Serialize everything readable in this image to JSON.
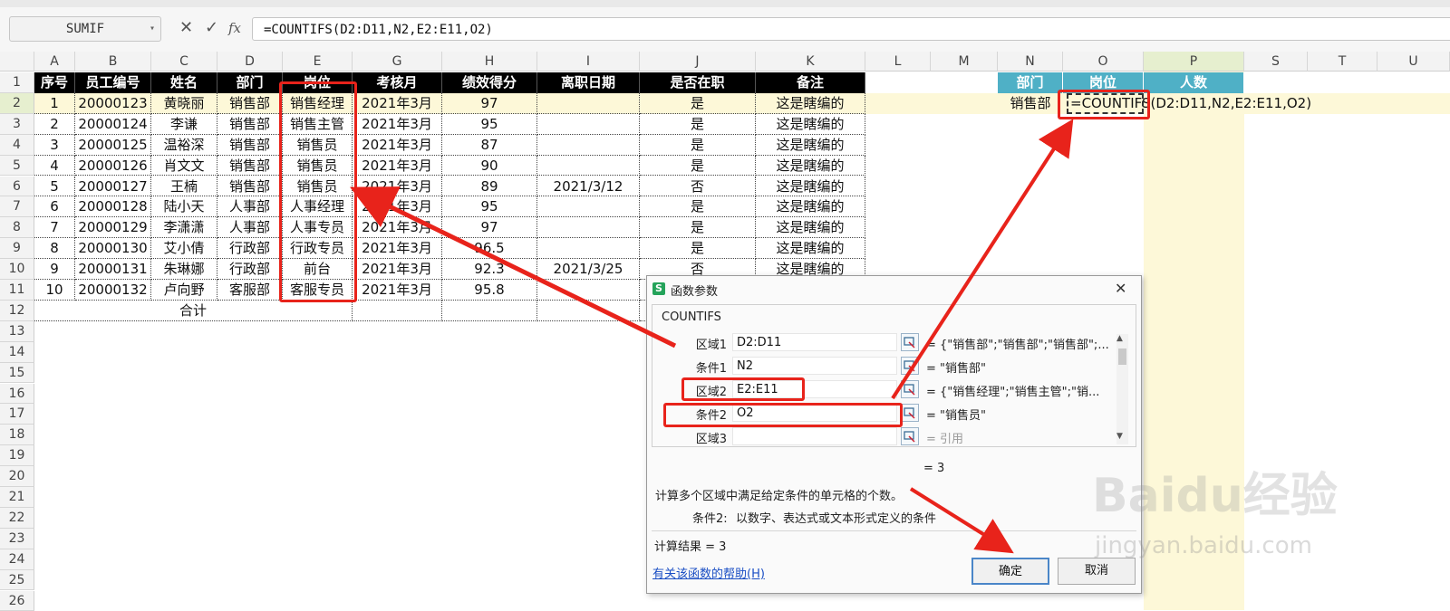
{
  "formula_bar": {
    "name_box": "SUMIF",
    "cancel_icon": "✕",
    "confirm_icon": "✓",
    "fx_label": "fx",
    "formula": "=COUNTIFS(D2:D11,N2,E2:E11,O2)"
  },
  "columns": [
    "A",
    "B",
    "C",
    "D",
    "E",
    "G",
    "H",
    "I",
    "J",
    "K",
    "L",
    "M",
    "N",
    "O",
    "P",
    "S",
    "T",
    "U"
  ],
  "rows": [
    "1",
    "2",
    "3",
    "4",
    "5",
    "6",
    "7",
    "8",
    "9",
    "10",
    "11",
    "12",
    "13",
    "14",
    "15",
    "16",
    "17",
    "18",
    "19",
    "20",
    "21",
    "22",
    "23",
    "24",
    "25",
    "26"
  ],
  "table": {
    "headers": [
      "序号",
      "员工编号",
      "姓名",
      "部门",
      "岗位",
      "考核月",
      "绩效得分",
      "离职日期",
      "是否在职",
      "备注"
    ],
    "rows": [
      [
        "1",
        "20000123",
        "黄晓丽",
        "销售部",
        "销售经理",
        "2021年3月",
        "97",
        "",
        "是",
        "这是瞎编的"
      ],
      [
        "2",
        "20000124",
        "李谦",
        "销售部",
        "销售主管",
        "2021年3月",
        "95",
        "",
        "是",
        "这是瞎编的"
      ],
      [
        "3",
        "20000125",
        "温裕深",
        "销售部",
        "销售员",
        "2021年3月",
        "87",
        "",
        "是",
        "这是瞎编的"
      ],
      [
        "4",
        "20000126",
        "肖文文",
        "销售部",
        "销售员",
        "2021年3月",
        "90",
        "",
        "是",
        "这是瞎编的"
      ],
      [
        "5",
        "20000127",
        "王楠",
        "销售部",
        "销售员",
        "2021年3月",
        "89",
        "2021/3/12",
        "否",
        "这是瞎编的"
      ],
      [
        "6",
        "20000128",
        "陆小天",
        "人事部",
        "人事经理",
        "2021年3月",
        "95",
        "",
        "是",
        "这是瞎编的"
      ],
      [
        "7",
        "20000129",
        "李潇潇",
        "人事部",
        "人事专员",
        "2021年3月",
        "97",
        "",
        "是",
        "这是瞎编的"
      ],
      [
        "8",
        "20000130",
        "艾小倩",
        "行政部",
        "行政专员",
        "2021年3月",
        "96.5",
        "",
        "是",
        "这是瞎编的"
      ],
      [
        "9",
        "20000131",
        "朱琳娜",
        "行政部",
        "前台",
        "2021年3月",
        "92.3",
        "2021/3/25",
        "否",
        "这是瞎编的"
      ],
      [
        "10",
        "20000132",
        "卢向野",
        "客服部",
        "客服专员",
        "2021年3月",
        "95.8",
        "",
        "",
        ""
      ]
    ],
    "total_label": "合计"
  },
  "criteria": {
    "headers": [
      "部门",
      "岗位",
      "人数"
    ],
    "dept_value": "销售部",
    "cell_formula": "=COUNTIFS(D2:D11,N2,E2:E11,O2)"
  },
  "dialog": {
    "title": "函数参数",
    "app_icon": "S",
    "close_icon": "✕",
    "function_name": "COUNTIFS",
    "args": [
      {
        "label": "区域1",
        "value": "D2:D11",
        "result": "= {\"销售部\";\"销售部\";\"销售部\";..."
      },
      {
        "label": "条件1",
        "value": "N2",
        "result": "= \"销售部\""
      },
      {
        "label": "区域2",
        "value": "E2:E11",
        "result": "= {\"销售经理\";\"销售主管\";\"销..."
      },
      {
        "label": "条件2",
        "value": "O2",
        "result": "= \"销售员\""
      },
      {
        "label": "区域3",
        "value": "",
        "result": "= 引用"
      }
    ],
    "formula_result": "= 3",
    "description": "计算多个区域中满足给定条件的单元格的个数。",
    "arg_help_label": "条件2:",
    "arg_help": "以数字、表达式或文本形式定义的条件",
    "calc_result": "计算结果 = 3",
    "help_link": "有关该函数的帮助(H)",
    "ok_label": "确定",
    "cancel_label": "取消"
  },
  "watermark": {
    "brand": "Baidu经验",
    "url": "jingyan.baidu.com"
  },
  "colors": {
    "header_fill": "#000000",
    "criteria_header_fill": "#4fb0c6",
    "highlight_column": "#fdf8d8",
    "annotation_red": "#e8231b"
  }
}
